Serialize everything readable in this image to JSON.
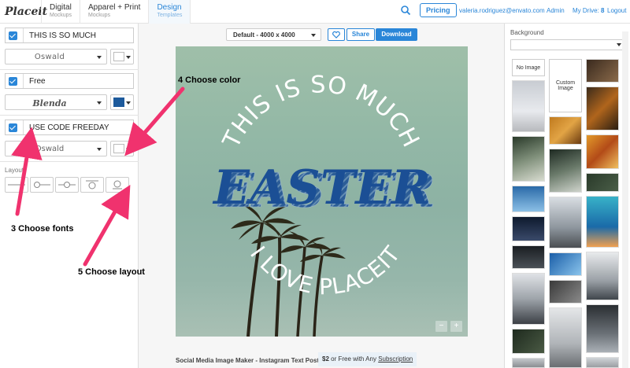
{
  "header": {
    "logo": "Placeit",
    "nav": [
      {
        "title": "Digital",
        "sub": "Mockups"
      },
      {
        "title": "Apparel + Print",
        "sub": "Mockups"
      },
      {
        "title": "Design",
        "sub": "Templates"
      }
    ],
    "pricing_label": "Pricing",
    "email": "valeria.rodriguez@envato.com",
    "admin": "Admin",
    "my_drive": "My Drive:",
    "my_drive_count": "8",
    "logout": "Logout"
  },
  "left_panel": {
    "text_rows": [
      {
        "text": "THIS IS SO MUCH",
        "font": "Oswald",
        "color": "#ffffff"
      },
      {
        "text": "Free",
        "font": "Blenda",
        "color": "#1d5a9c"
      },
      {
        "text": "USE CODE FREEDAY",
        "font": "Oswald",
        "color": "#ffffff"
      }
    ],
    "layout_label": "Layout"
  },
  "toolbar": {
    "size_label": "Default - 4000 x 4000",
    "share_label": "Share",
    "download_label": "Download"
  },
  "artboard": {
    "top_text": "THIS IS SO MUCH",
    "center_text": "EASTER",
    "bottom_text": "I LOVE PLACEIT",
    "zoom_out": "−",
    "zoom_in": "+"
  },
  "footer": {
    "caption": "Social Media Image Maker - Instagram Text Post",
    "price": "$2",
    "price_rest": "or Free with Any",
    "subscription": "Subscription"
  },
  "right_panel": {
    "label": "Background",
    "no_image": "No Image",
    "custom_image": "Custom Image"
  },
  "annotations": {
    "a1": "4 Choose color",
    "a2": "3 Choose fonts",
    "a3": "5 Choose layout"
  }
}
